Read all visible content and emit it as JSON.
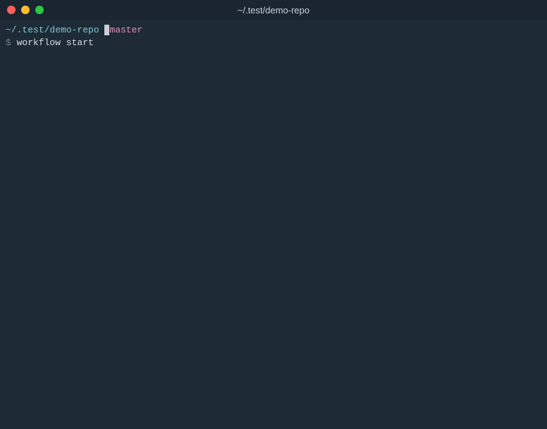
{
  "titlebar": {
    "title": "~/.test/demo-repo"
  },
  "prompt": {
    "cwd": "~/.test/demo-repo",
    "branch_first_char": "⎇",
    "branch_rest": "master"
  },
  "command": {
    "prompt_symbol": "$ ",
    "text": "workflow start"
  }
}
